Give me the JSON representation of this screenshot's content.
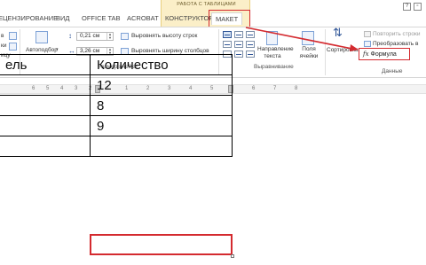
{
  "tabs": {
    "review": "ЕЦЕНЗИРОВАНИЕ",
    "view": "ВИД",
    "office_tab": "OFFICE TAB",
    "acrobat": "ACROBAT",
    "constructor": "КОНСТРУКТОР",
    "layout": "МАКЕТ",
    "context_group": "РАБОТА С ТАБЛИЦАМИ"
  },
  "ribbon": {
    "left_fragments": [
      "в",
      "ки",
      "ицу"
    ],
    "autofit": "Автоподбор",
    "height_value": "0,21 см",
    "width_value": "3,26 см",
    "distribute_rows": "Выровнять высоту строк",
    "distribute_cols": "Выровнять ширину столбцов",
    "cell_size_group": "Размер ячейки",
    "text_direction": "Направление текста",
    "cell_margins": "Поля ячейки",
    "alignment_group": "Выравнивание",
    "sort": "Сортировка",
    "repeat_header": "Повторить строки",
    "convert_to_text": "Преобразовать в",
    "formula": "Формула",
    "data_group": "Данные"
  },
  "ruler": {
    "numbers": [
      "6",
      "5",
      "4",
      "3",
      "2",
      "1",
      "1",
      "2",
      "3",
      "4",
      "5",
      "6",
      "7",
      "8"
    ]
  },
  "table": {
    "header": [
      "ель",
      "Количество"
    ],
    "rows": [
      [
        "",
        "12"
      ],
      [
        "",
        "8"
      ],
      [
        "",
        "9"
      ],
      [
        "",
        ""
      ]
    ]
  },
  "colors": {
    "highlight": "#d42a2f",
    "context_tab": "#fbefc8"
  }
}
